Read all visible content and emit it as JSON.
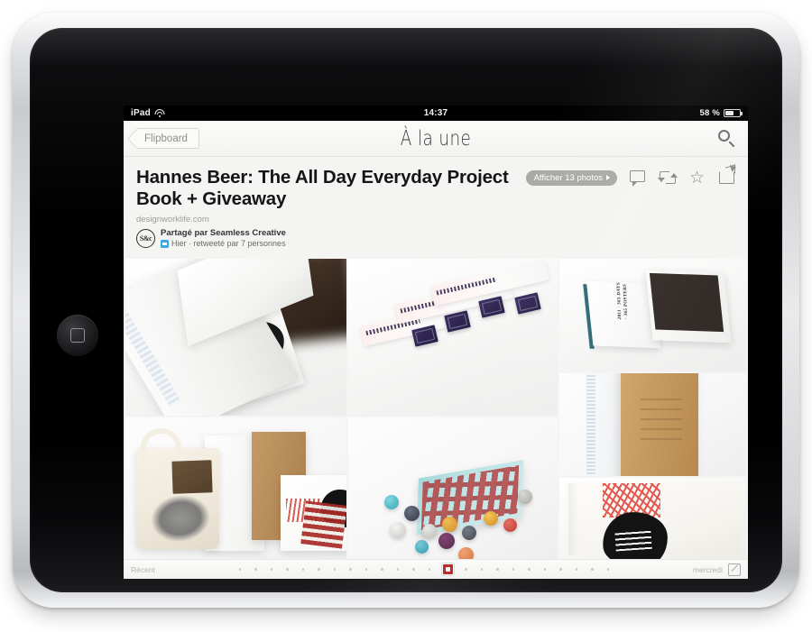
{
  "device": {
    "name": "ipad",
    "home_button": "home-button"
  },
  "status_bar": {
    "carrier": "iPad",
    "wifi_icon": "wifi-icon",
    "time": "14:37",
    "battery_percent": "58 %",
    "battery_icon": "battery-icon"
  },
  "navbar": {
    "back_label": "Flipboard",
    "back_icon": "chevron-left-icon",
    "title": "À la une",
    "search_icon": "search-icon"
  },
  "article": {
    "headline": "Hannes Beer: The All Day Everyday Project Book + Giveaway",
    "source": "designworklife.com",
    "avatar_text": "S&c",
    "shared_by": "Partagé par Seamless Creative",
    "meta": "Hier · retweeté par 7 personnes",
    "twitter_badge_icon": "twitter-icon"
  },
  "actions": {
    "photos_pill": "Afficher 13 photos",
    "photos_pill_arrow_icon": "triangle-right-icon",
    "comment_icon": "comment-icon",
    "retweet_icon": "retweet-icon",
    "star_icon": "star-icon",
    "star_glyph": "☆",
    "share_icon": "share-icon"
  },
  "grid": {
    "photos": [
      {
        "name": "photo-open-box-book",
        "alt": "Open white box with book and black silhouette card"
      },
      {
        "name": "photo-tickets-stamps",
        "alt": "Printed paper tickets with purple stamps on white surface"
      },
      {
        "name": "photo-open-book-365-posters",
        "alt": "Open book spread reading 2011 365 DAYS 365 POSTERS"
      },
      {
        "name": "photo-tote-bag-set",
        "alt": "Canvas tote bag, books and printed cards"
      },
      {
        "name": "photo-pin-badges",
        "alt": "Scattered colourful pin badges with printed poster"
      },
      {
        "name": "photo-kraft-notebook",
        "alt": "Kraft brown embossed notebook beside white book"
      },
      {
        "name": "photo-head-print",
        "alt": "Poster with black head silhouette and red scribble print"
      }
    ],
    "book_spread_text": [
      "2011",
      "•",
      "365",
      "DAYS",
      "•",
      "365",
      "POSTERS"
    ]
  },
  "bottom_bar": {
    "left_label": "Récent",
    "right_label": "mercredi",
    "dots_before": 13,
    "dots_after": 10,
    "active_indicator_color": "#b7231d",
    "compose_icon": "compose-icon"
  }
}
